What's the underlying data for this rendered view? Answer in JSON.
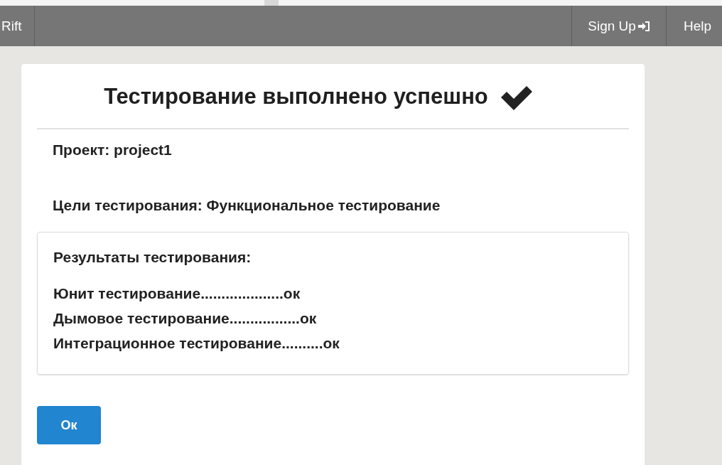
{
  "navbar": {
    "brand": "Rift",
    "links": [
      {
        "label": "Sign Up"
      },
      {
        "label": "Help"
      }
    ]
  },
  "dialog": {
    "title": "Тестирование выполнено успешно",
    "success": true,
    "project": "Проект: project1",
    "goals": "Цели тестирования: Функциональное тестирование",
    "results": {
      "heading": "Результаты тестирования:",
      "lines": [
        "Юнит тестирование....................ок",
        "Дымовое тестирование.................ок",
        "Интеграционное тестирование..........ок"
      ]
    },
    "button": "Ок"
  }
}
